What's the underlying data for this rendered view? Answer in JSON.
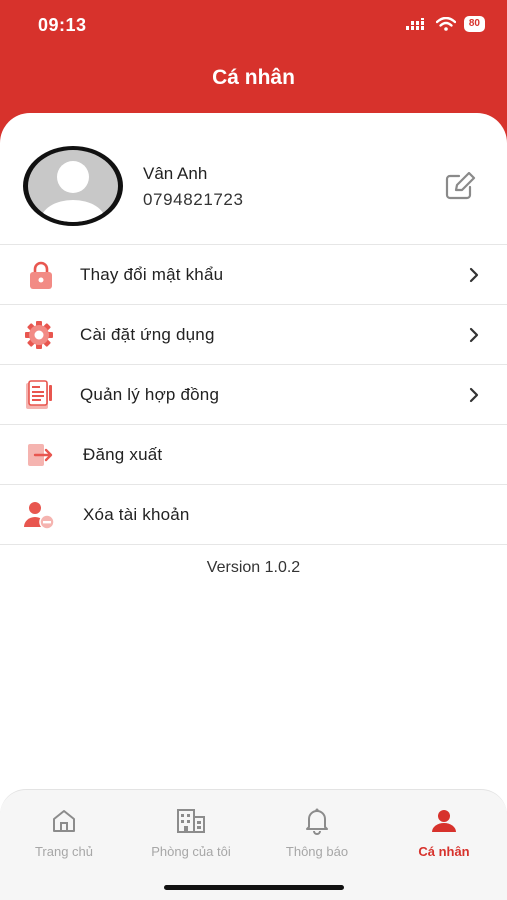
{
  "status_bar": {
    "time": "09:13",
    "battery": "80"
  },
  "header": {
    "title": "Cá nhân"
  },
  "profile": {
    "name": "Vân Anh",
    "phone": "0794821723"
  },
  "menu": [
    {
      "label": "Thay đổi mật khẩu",
      "icon": "lock-icon",
      "has_chevron": true
    },
    {
      "label": "Cài đặt ứng dụng",
      "icon": "gear-icon",
      "has_chevron": true
    },
    {
      "label": "Quản lý hợp đồng",
      "icon": "contract-icon",
      "has_chevron": true
    },
    {
      "label": "Đăng xuất",
      "icon": "logout-icon",
      "has_chevron": false
    },
    {
      "label": "Xóa tài khoản",
      "icon": "delete-user-icon",
      "has_chevron": false
    }
  ],
  "version": "Version 1.0.2",
  "tabs": [
    {
      "label": "Trang chủ",
      "icon": "home-icon",
      "active": false
    },
    {
      "label": "Phòng của tôi",
      "icon": "building-icon",
      "active": false
    },
    {
      "label": "Thông báo",
      "icon": "bell-icon",
      "active": false
    },
    {
      "label": "Cá nhân",
      "icon": "person-icon",
      "active": true
    }
  ],
  "colors": {
    "primary": "#d7322c",
    "icon_tint": "#e8564f",
    "inactive": "#a7a7a7"
  }
}
